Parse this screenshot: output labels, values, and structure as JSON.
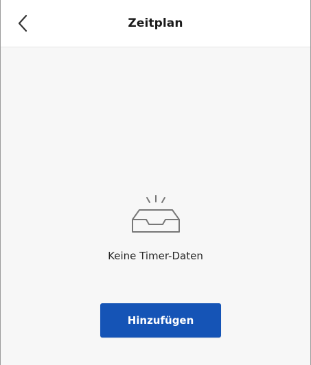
{
  "header": {
    "title": "Zeitplan",
    "back_icon": "chevron-left-icon"
  },
  "empty_state": {
    "icon": "empty-inbox-icon",
    "message": "Keine Timer-Daten"
  },
  "actions": {
    "add_label": "Hinzufügen"
  },
  "colors": {
    "accent": "#1554b6",
    "background": "#f7f7f7",
    "header_background": "#ffffff"
  }
}
